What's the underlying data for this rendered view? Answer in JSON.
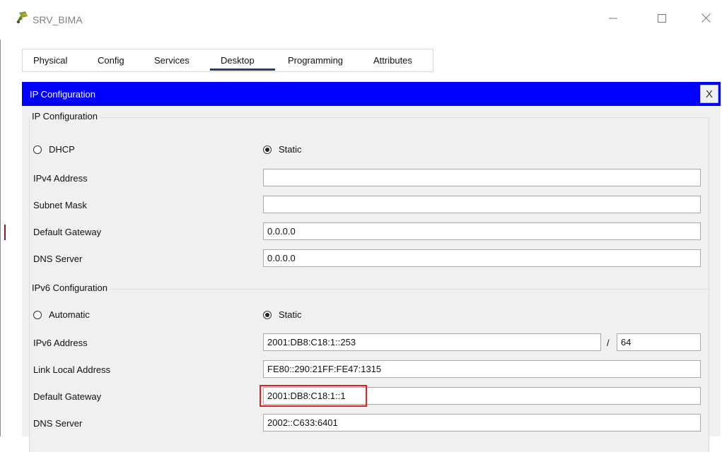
{
  "window": {
    "title": "SRV_BIMA",
    "icons": {
      "app": "router-app-icon",
      "minimize": "minimize-icon",
      "maximize": "maximize-icon",
      "close": "close-icon"
    }
  },
  "tabs": [
    {
      "label": "Physical"
    },
    {
      "label": "Config"
    },
    {
      "label": "Services"
    },
    {
      "label": "Desktop",
      "selected": true
    },
    {
      "label": "Programming"
    },
    {
      "label": "Attributes"
    }
  ],
  "panel": {
    "title": "IP Configuration",
    "close_label": "X",
    "header_color": "#0000FF"
  },
  "ipv4": {
    "legend": "IP Configuration",
    "dhcp_label": "DHCP",
    "static_label": "Static",
    "mode": "Static",
    "fields": [
      {
        "label": "IPv4 Address",
        "value": ""
      },
      {
        "label": "Subnet Mask",
        "value": ""
      },
      {
        "label": "Default Gateway",
        "value": "0.0.0.0"
      },
      {
        "label": "DNS Server",
        "value": "0.0.0.0"
      }
    ]
  },
  "ipv6": {
    "legend": "IPv6 Configuration",
    "automatic_label": "Automatic",
    "static_label": "Static",
    "mode": "Static",
    "address_label": "IPv6 Address",
    "address_value": "2001:DB8:C18:1::253",
    "prefix_separator": "/",
    "prefix_value": "64",
    "link_local_label": "Link Local Address",
    "link_local_value": "FE80::290:21FF:FE47:1315",
    "gateway_label": "Default Gateway",
    "gateway_value": "2001:DB8:C18:1::1",
    "dns_label": "DNS Server",
    "dns_value": "2002::C633:6401"
  },
  "highlight_color": "#E02020"
}
